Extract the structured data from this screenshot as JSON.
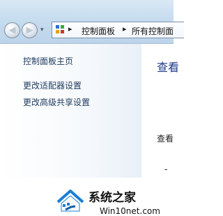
{
  "navigation": {
    "back_glyph": "◀",
    "forward_glyph": "▶",
    "dropdown_glyph": "▾"
  },
  "address_bar": {
    "icon": "control-panel-icon",
    "separator": "▸",
    "crumbs": [
      "控制面板",
      "所有控制面"
    ]
  },
  "sidebar": {
    "links": [
      "控制面板主页",
      "更改适配器设置",
      "更改高级共享设置"
    ]
  },
  "main": {
    "title": "查看",
    "text": "查看"
  },
  "watermark": {
    "title": "系统之家",
    "url": "Win10net.com",
    "trailing": "-"
  },
  "colors": {
    "link": "#1e3a5e",
    "title": "#1e3a8a",
    "titlebar": "#c6dcef"
  }
}
